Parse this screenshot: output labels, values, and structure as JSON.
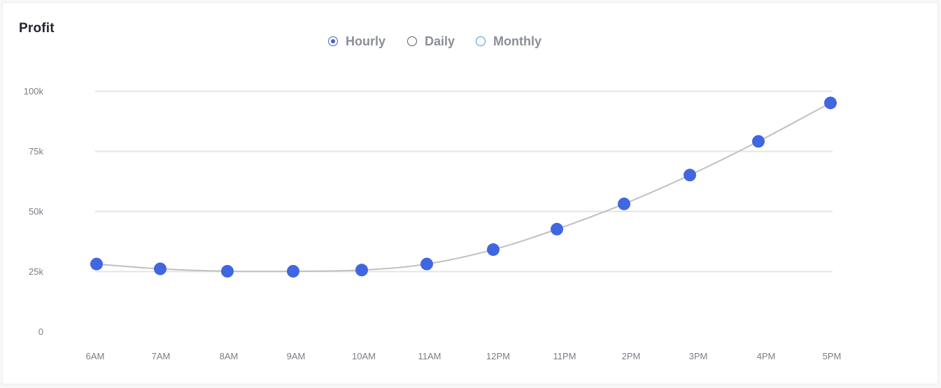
{
  "card": {
    "title": "Profit"
  },
  "filters": [
    {
      "label": "Hourly",
      "selected": true,
      "radio_color": "#3e61d6"
    },
    {
      "label": "Daily",
      "selected": false,
      "radio_color": "#5c5f68"
    },
    {
      "label": "Monthly",
      "selected": false,
      "radio_color": "#3aa1dd"
    }
  ],
  "chart_data": {
    "type": "line",
    "title": "Profit",
    "xlabel": "",
    "ylabel": "",
    "categories": [
      "6AM",
      "7AM",
      "8AM",
      "9AM",
      "10AM",
      "11AM",
      "12PM",
      "11PM",
      "2PM",
      "3PM",
      "4PM",
      "5PM"
    ],
    "series": [
      {
        "values": [
          28000,
          26000,
          25000,
          25000,
          25500,
          28000,
          34000,
          42500,
          53000,
          65000,
          79000,
          95000
        ],
        "marker_color": "#4066e0",
        "line_color": "#bfc0c6"
      }
    ],
    "yticks": [
      0,
      25000,
      50000,
      75000,
      100000
    ],
    "ytick_labels": [
      "0",
      "25k",
      "50k",
      "75k",
      "100k"
    ],
    "ylim": [
      0,
      100000
    ],
    "grid": true,
    "gridline_color": "#e3e4e8",
    "smooth": true
  }
}
